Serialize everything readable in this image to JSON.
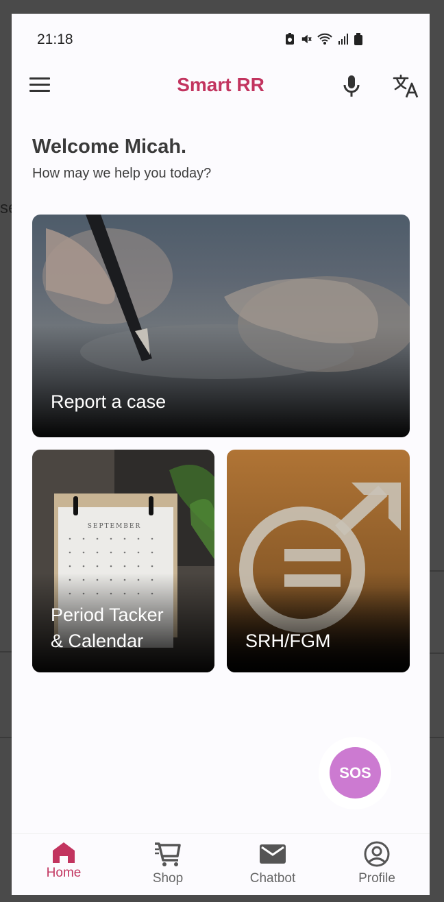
{
  "status": {
    "time": "21:18"
  },
  "app": {
    "title": "Smart RR"
  },
  "header": {
    "welcome": "Welcome Micah.",
    "subtitle": "How may we help you today?"
  },
  "cards": {
    "report": "Report a case",
    "period_line1": "Period Tacker",
    "period_line2": "& Calendar",
    "srh": "SRH/FGM",
    "calendar_month": "SEPTEMBER"
  },
  "sos": {
    "label": "SOS"
  },
  "nav": {
    "home": "Home",
    "shop": "Shop",
    "chatbot": "Chatbot",
    "profile": "Profile",
    "active": "home"
  },
  "colors": {
    "brand": "#c2345f",
    "sos": "#cc7ad1",
    "srh_card": "#b07435"
  },
  "icons": [
    "menu-icon",
    "mic-icon",
    "translate-icon",
    "home-icon",
    "shop-cart-icon",
    "mail-icon",
    "profile-icon",
    "gender-equality-icon"
  ]
}
